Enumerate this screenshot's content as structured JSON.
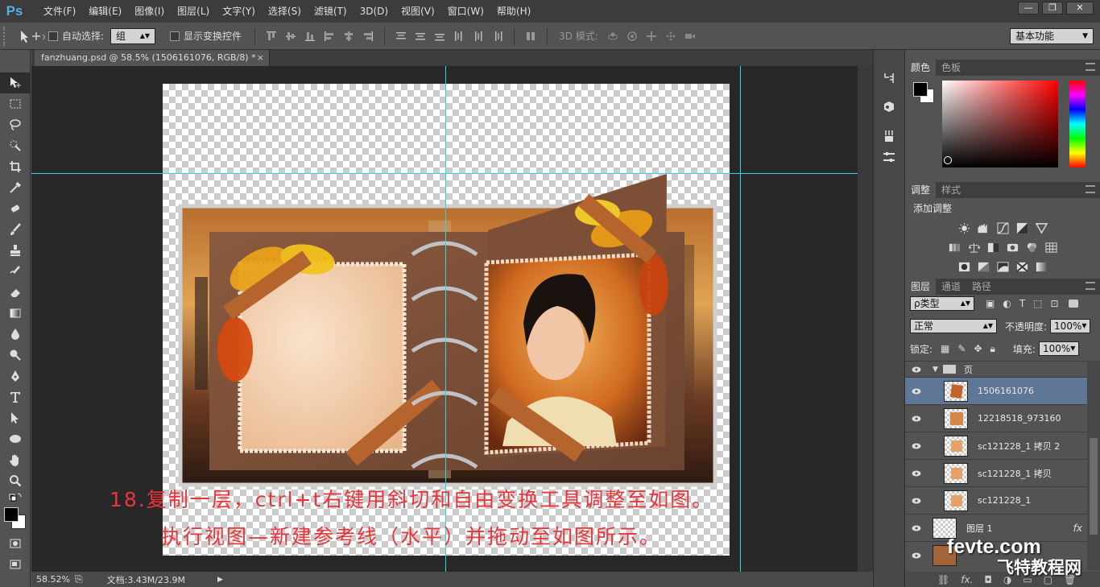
{
  "app": {
    "logo": "Ps"
  },
  "menu": [
    "文件(F)",
    "编辑(E)",
    "图像(I)",
    "图层(L)",
    "文字(Y)",
    "选择(S)",
    "滤镜(T)",
    "3D(D)",
    "视图(V)",
    "窗口(W)",
    "帮助(H)"
  ],
  "options": {
    "auto_select": "自动选择:",
    "group_value": "组",
    "show_transform": "显示变换控件",
    "mode_3d": "3D 模式:",
    "workspace": "基本功能"
  },
  "document": {
    "tab_title": "fanzhuang.psd @ 58.5% (1506161076, RGB/8) *",
    "zoom": "58.52%",
    "doc_size": "文档:3.43M/23.9M"
  },
  "annotation": {
    "line1": "18.复制一层，ctrl+t右键用斜切和自由变换工具调整至如图。",
    "line2": "执行视图—新建参考线（水平）并拖动至如图所示。"
  },
  "panels": {
    "color_tab": "颜色",
    "swatch_tab": "色板",
    "adjust_tab": "调整",
    "style_tab": "样式",
    "add_adjustment": "添加调整",
    "layers_tab": "图层",
    "channels_tab": "通道",
    "paths_tab": "路径",
    "filter_kind": "ρ类型",
    "blend_mode": "正常",
    "opacity_label": "不透明度:",
    "opacity_value": "100%",
    "lock_label": "锁定:",
    "fill_label": "填充:",
    "fill_value": "100%",
    "group_name": "页",
    "layers": [
      {
        "name": "1506161076",
        "selected": true
      },
      {
        "name": "12218518_973160",
        "selected": false
      },
      {
        "name": "sc121228_1 拷贝 2",
        "selected": false
      },
      {
        "name": "sc121228_1 拷贝",
        "selected": false
      },
      {
        "name": "sc121228_1",
        "selected": false
      },
      {
        "name": "图层 1",
        "selected": false,
        "fx": "fx"
      },
      {
        "name": "",
        "selected": false
      }
    ]
  },
  "watermark": {
    "site": "fevte.com",
    "name": "飞特教程网"
  },
  "colors": {
    "accent": "#5f7797",
    "guide": "#31d4e4",
    "annotation": "#e8353c"
  }
}
